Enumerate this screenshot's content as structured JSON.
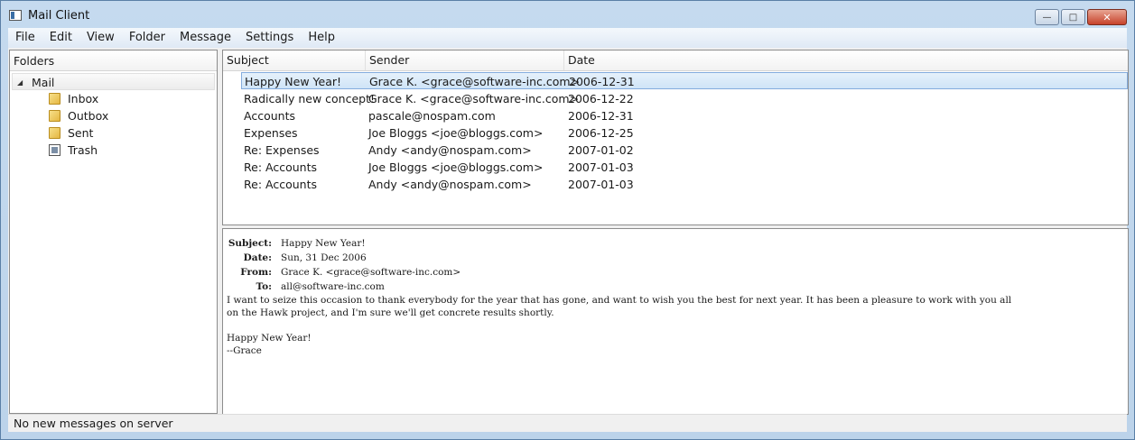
{
  "window": {
    "title": "Mail Client",
    "minimize_glyph": "—",
    "maximize_glyph": "□",
    "close_glyph": "✕"
  },
  "menu": [
    "File",
    "Edit",
    "View",
    "Folder",
    "Message",
    "Settings",
    "Help"
  ],
  "folders": {
    "header": "Folders",
    "root": {
      "label": "Mail",
      "arrow": "◢"
    },
    "children": [
      {
        "label": "Inbox",
        "icon": "folder-icon"
      },
      {
        "label": "Outbox",
        "icon": "folder-icon"
      },
      {
        "label": "Sent",
        "icon": "folder-icon"
      },
      {
        "label": "Trash",
        "icon": "trash-icon"
      }
    ]
  },
  "message_list": {
    "columns": [
      "Subject",
      "Sender",
      "Date"
    ],
    "rows": [
      {
        "subject": "Happy New Year!",
        "sender": "Grace K. <grace@software-inc.com>",
        "date": "2006-12-31",
        "selected": true
      },
      {
        "subject": "Radically new concept!",
        "sender": "Grace K. <grace@software-inc.com>",
        "date": "2006-12-22"
      },
      {
        "subject": "Accounts",
        "sender": "pascale@nospam.com",
        "date": "2006-12-31"
      },
      {
        "subject": "Expenses",
        "sender": "Joe Bloggs <joe@bloggs.com>",
        "date": "2006-12-25"
      },
      {
        "subject": "Re: Expenses",
        "sender": "Andy <andy@nospam.com>",
        "date": "2007-01-02"
      },
      {
        "subject": "Re: Accounts",
        "sender": "Joe Bloggs <joe@bloggs.com>",
        "date": "2007-01-03"
      },
      {
        "subject": "Re: Accounts",
        "sender": "Andy <andy@nospam.com>",
        "date": "2007-01-03"
      }
    ]
  },
  "preview": {
    "headers": [
      {
        "key": "Subject:",
        "value": "Happy New Year!"
      },
      {
        "key": "Date:",
        "value": "Sun, 31 Dec 2006"
      },
      {
        "key": "From:",
        "value": "Grace K. <grace@software-inc.com>"
      },
      {
        "key": "To:",
        "value": "all@software-inc.com"
      }
    ],
    "body": "I want to seize this occasion to thank everybody for the year that has gone, and want to wish you the best for next year. It has been a pleasure to work with you all\non the Hawk project, and I'm sure we'll get concrete results shortly.\n\nHappy New Year!\n--Grace"
  },
  "status": "No new messages on server"
}
